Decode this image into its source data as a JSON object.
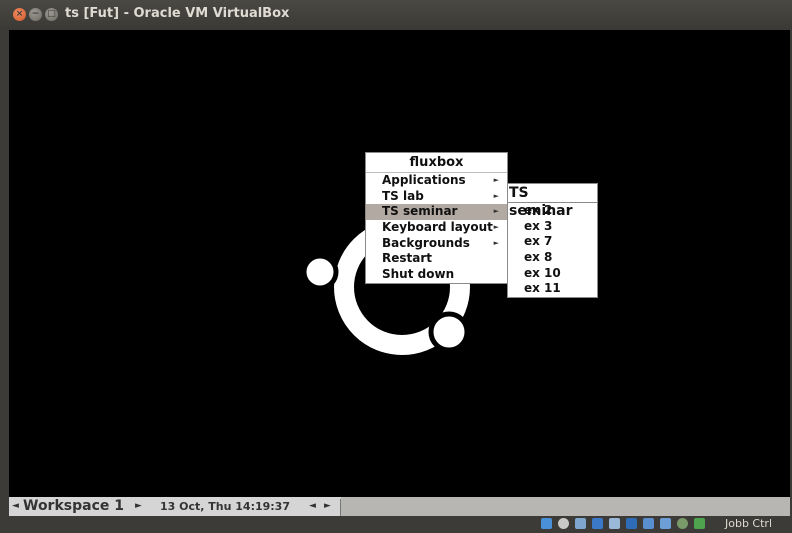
{
  "window": {
    "title": "ts [Fut] - Oracle VM VirtualBox"
  },
  "menu": {
    "title": "fluxbox",
    "items": [
      {
        "label": "Applications",
        "submenu": true
      },
      {
        "label": "TS lab",
        "submenu": true
      },
      {
        "label": "TS seminar",
        "submenu": true,
        "highlighted": true
      },
      {
        "label": "Keyboard layout",
        "submenu": true
      },
      {
        "label": "Backgrounds",
        "submenu": true
      },
      {
        "label": "Restart",
        "submenu": false
      },
      {
        "label": "Shut down",
        "submenu": false
      }
    ],
    "arrow_glyph": "►"
  },
  "submenu": {
    "title": "TS seminar",
    "items": [
      "ex 2",
      "ex 3",
      "ex 7",
      "ex 8",
      "ex 10",
      "ex 11"
    ]
  },
  "toolbar": {
    "prev_glyph": "◄",
    "workspace": "Workspace 1",
    "next_glyph": "►",
    "clock": "13 Oct, Thu 14:19:37",
    "left_glyph": "◄",
    "right_glyph": "►"
  },
  "statusbar": {
    "host_key": "Jobb Ctrl",
    "icons": [
      "hard-disk-icon",
      "optical-drive-icon",
      "usb-icon",
      "shared-folders-icon",
      "display-icon",
      "network-icon",
      "network-2-icon",
      "recording-icon",
      "mouse-integration-icon",
      "capture-icon"
    ]
  },
  "colors": {
    "menu_highlight": "#b2aaa2",
    "toolbar_bg": "#d5d5d5",
    "titlebar_bg": "#3c3b37"
  }
}
